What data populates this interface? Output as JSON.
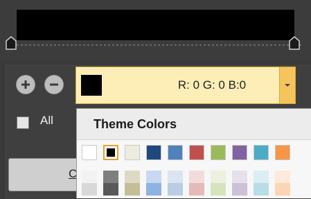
{
  "color_field": {
    "text": "R: 0 G: 0 B:0",
    "value_hex": "#000000"
  },
  "checkbox": {
    "label": "All",
    "checked": false
  },
  "ok_button": {
    "label_visible": "C"
  },
  "popup": {
    "title": "Theme Colors",
    "theme_row": [
      "#ffffff",
      "#000000",
      "#eeece1",
      "#1f497d",
      "#4f81bd",
      "#c0504d",
      "#9bbb59",
      "#8064a2",
      "#4bacc6",
      "#f79646"
    ],
    "selected_index": 1,
    "tint_rows": [
      [
        "#f2f2f2",
        "#7f7f7f",
        "#ddd9c3",
        "#c6d9f0",
        "#dbe5f1",
        "#f2dcdb",
        "#ebf1dd",
        "#e5e0ec",
        "#dbeef3",
        "#fdeada"
      ],
      [
        "#d8d8d8",
        "#595959",
        "#c4bd97",
        "#8db3e2",
        "#b8cce4",
        "#e5b9b7",
        "#d7e3bc",
        "#ccc1d9",
        "#b7dde8",
        "#fbd5b5"
      ]
    ]
  },
  "icons": {
    "add": "plus-circle-icon",
    "remove": "minus-circle-icon",
    "dropdown": "chevron-down-icon",
    "stop": "gradient-stop-icon"
  }
}
